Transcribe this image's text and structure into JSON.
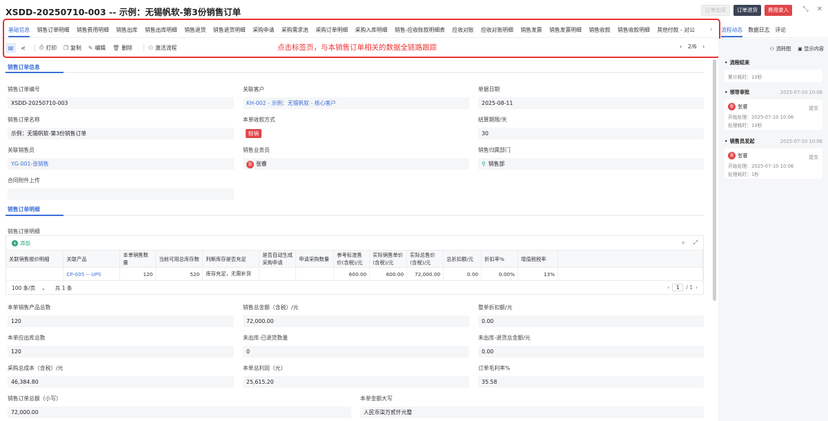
{
  "header": {
    "title": "XSDD-20250710-003 -- 示例：无锡帆软-第3份销售订单",
    "buttons": [
      "订单出库",
      "订单退货",
      "费用录入"
    ]
  },
  "tabs": [
    "基础信息",
    "销售订单明细",
    "销售费用明细",
    "销售出库",
    "销售出库明细",
    "销售退货",
    "销售退货明细",
    "采购申请",
    "采购需求池",
    "采购订单明细",
    "采购入库明细",
    "销售-应收账款明细表",
    "应收对账",
    "应收对账明细",
    "销售发票",
    "销售发票明细",
    "销售收款",
    "销售收款明细",
    "其他付款 - 对公"
  ],
  "right_tabs": [
    "流程动态",
    "数据日志",
    "评论"
  ],
  "toolbar": {
    "print": "打印",
    "copy": "复制",
    "edit": "编辑",
    "delete": "删除",
    "activate": "激活流程",
    "page": "2/6"
  },
  "annotation": "点击标签页，与本销售订单相关的数据全链路跟踪",
  "order_info": {
    "section": "销售订单信息",
    "order_no_label": "销售订单编号",
    "order_no": "XSDD-20250710-003",
    "customer_label": "关联客户",
    "customer": "KH-002 - 示例：无锡帆软 - 核心客户",
    "date_label": "单据日期",
    "date": "2025-08-11",
    "name_label": "销售订单名称",
    "name": "示例：无锡帆软-第3份销售订单",
    "payment_label": "本单收款方式",
    "payment": "赊销",
    "term_label": "结算期限/天",
    "term": "30",
    "salesman_label": "关联销售员",
    "salesman": "YG-001-张销售",
    "clerk_label": "销售业务员",
    "clerk": "张睿",
    "clerk_avatar": "张",
    "dept_label": "销售归属部门",
    "dept": "销售部",
    "attach_label": "合同附件上传"
  },
  "detail": {
    "section": "销售订单明细",
    "sub_label": "销售订单明细",
    "add": "添加",
    "columns": [
      "关联销售报价明细",
      "关联产品",
      "本单销售数量",
      "当前可用总库存数",
      "判断库存是否充足",
      "是否自动生成采购申请",
      "申请采购数量",
      "参考标准售价(含税)/元",
      "实际销售单价(含税)/元",
      "实际总售价(含税)/元",
      "总折扣额/元",
      "折扣率%",
      "增值税税率"
    ],
    "rows": [
      [
        "",
        "CP-005 -- UPS",
        "120",
        "520",
        "库存充足，无需补货",
        "",
        "",
        "600.00",
        "600.00",
        "72,000.00",
        "0.00",
        "0.00%",
        "13%"
      ]
    ],
    "page_size": "100 条/页",
    "total": "共 1 条",
    "page_cur": "1",
    "page_total": "/ 1"
  },
  "summary": {
    "f1_label": "本单销售产品总数",
    "f1": "120",
    "f2_label": "销售总金额（含税）/元",
    "f2": "72,000.00",
    "f3_label": "整单折扣额/元",
    "f3": "0.00",
    "f4_label": "本单应出库总数",
    "f4": "120",
    "f5_label": "未出库-已退货数量",
    "f5": "0",
    "f6_label": "未出库-退货总金额/元",
    "f6": "0.00",
    "f7_label": "采购总成本（含税）/元",
    "f7": "46,384.80",
    "f8_label": "本单总利润（元）",
    "f8": "25,615.20",
    "f9_label": "订单毛利率%",
    "f9": "35.58",
    "f10_label": "销售订单总额（小写）",
    "f10": "72,000.00",
    "f11_label": "本单金额大写",
    "f11": "人民币柒万贰仟元整"
  },
  "flow": {
    "flowchart": "流转图",
    "show_content": "显示内容",
    "end_label": "流程结束",
    "total_time": "累计耗时：13秒",
    "steps": [
      {
        "name": "领导审批",
        "time": "2025-07-10 10:06",
        "user": "张睿",
        "avatar": "张",
        "action": "提交",
        "start": "开始处理：2025-07-10 10:06",
        "cost": "处理耗时：13秒"
      },
      {
        "name": "销售员发起",
        "time": "2025-07-10 10:06",
        "user": "张睿",
        "avatar": "张",
        "action": "提交",
        "start": "开始处理：2025-07-10 10:06",
        "cost": "处理耗时：1秒"
      }
    ]
  }
}
